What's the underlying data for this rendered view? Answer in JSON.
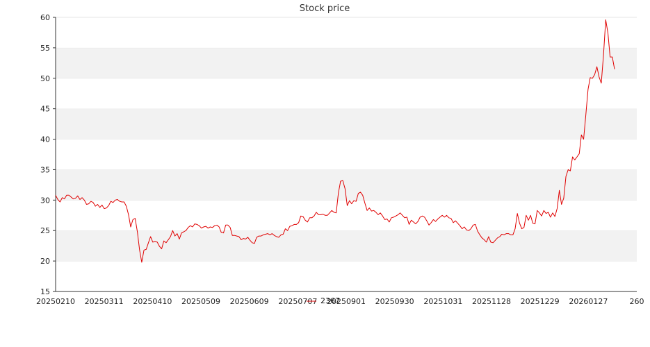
{
  "chart_data": {
    "type": "line",
    "title": "Stock price",
    "xlabel": "",
    "ylabel": "",
    "ylim": [
      15,
      60
    ],
    "yticks": [
      15,
      20,
      25,
      30,
      35,
      40,
      45,
      50,
      55,
      60
    ],
    "grid": "horizontal bands, alternating",
    "legend_position": "bottom-center",
    "x_tick_labels": [
      "20250210",
      "20250311",
      "20250410",
      "20250509",
      "20250609",
      "20250707",
      "20250901",
      "20250930",
      "20251031",
      "20251128",
      "20251229",
      "20260127",
      "260"
    ],
    "series": [
      {
        "name": "2367",
        "color": "#e00000",
        "values": [
          30.8,
          30.1,
          29.7,
          30.4,
          30.2,
          30.8,
          30.8,
          30.5,
          30.2,
          30.3,
          30.7,
          30.1,
          30.4,
          30.0,
          29.3,
          29.4,
          29.8,
          29.6,
          29.0,
          29.3,
          28.8,
          29.2,
          28.6,
          28.7,
          29.1,
          29.8,
          29.6,
          30.0,
          30.1,
          29.8,
          29.7,
          29.7,
          29.0,
          27.6,
          25.6,
          26.8,
          27.0,
          24.8,
          21.8,
          19.8,
          21.8,
          21.9,
          23.0,
          24.0,
          23.1,
          23.2,
          23.1,
          22.4,
          22.0,
          23.3,
          23.0,
          23.5,
          24.0,
          25.0,
          24.1,
          24.5,
          23.6,
          24.6,
          24.8,
          25.0,
          25.5,
          25.8,
          25.6,
          26.1,
          26.0,
          25.8,
          25.4,
          25.6,
          25.7,
          25.4,
          25.6,
          25.5,
          25.8,
          25.9,
          25.6,
          24.7,
          24.6,
          25.9,
          25.9,
          25.5,
          24.2,
          24.2,
          24.1,
          24.0,
          23.5,
          23.7,
          23.6,
          23.9,
          23.4,
          23.0,
          22.9,
          23.9,
          24.1,
          24.1,
          24.3,
          24.4,
          24.5,
          24.3,
          24.5,
          24.2,
          24.0,
          23.9,
          24.3,
          24.4,
          25.3,
          25.0,
          25.7,
          25.8,
          26.0,
          26.0,
          26.3,
          27.4,
          27.3,
          26.7,
          26.4,
          27.1,
          27.1,
          27.4,
          28.0,
          27.6,
          27.6,
          27.7,
          27.5,
          27.5,
          27.9,
          28.3,
          28.0,
          27.9,
          31.2,
          33.1,
          33.2,
          31.9,
          29.1,
          29.9,
          29.4,
          29.9,
          29.8,
          31.1,
          31.3,
          30.8,
          29.5,
          28.3,
          28.7,
          28.2,
          28.3,
          28.0,
          27.6,
          27.9,
          27.4,
          26.8,
          26.9,
          26.4,
          27.1,
          27.2,
          27.4,
          27.6,
          27.9,
          27.5,
          27.1,
          27.2,
          26.0,
          26.7,
          26.4,
          26.1,
          26.5,
          27.2,
          27.4,
          27.2,
          26.6,
          25.9,
          26.3,
          26.8,
          26.5,
          26.9,
          27.2,
          27.5,
          27.2,
          27.5,
          27.1,
          27.0,
          26.3,
          26.6,
          26.2,
          25.8,
          25.3,
          25.6,
          25.1,
          25.0,
          25.3,
          25.9,
          26.0,
          24.9,
          24.3,
          23.8,
          23.5,
          23.1,
          24.0,
          23.1,
          23.0,
          23.4,
          23.8,
          24.0,
          24.4,
          24.3,
          24.5,
          24.5,
          24.3,
          24.3,
          25.3,
          27.8,
          26.2,
          25.3,
          25.5,
          27.5,
          26.7,
          27.5,
          26.2,
          26.1,
          28.3,
          27.9,
          27.4,
          28.3,
          27.8,
          28.0,
          27.2,
          27.9,
          27.3,
          28.6,
          31.6,
          29.3,
          30.3,
          33.9,
          35.0,
          34.8,
          37.1,
          36.6,
          37.1,
          37.6,
          40.7,
          40.0,
          44.0,
          48.2,
          50.1,
          50.0,
          50.6,
          51.9,
          50.2,
          49.2,
          53.8,
          59.6,
          57.4,
          53.5,
          53.5,
          51.5
        ]
      }
    ]
  }
}
